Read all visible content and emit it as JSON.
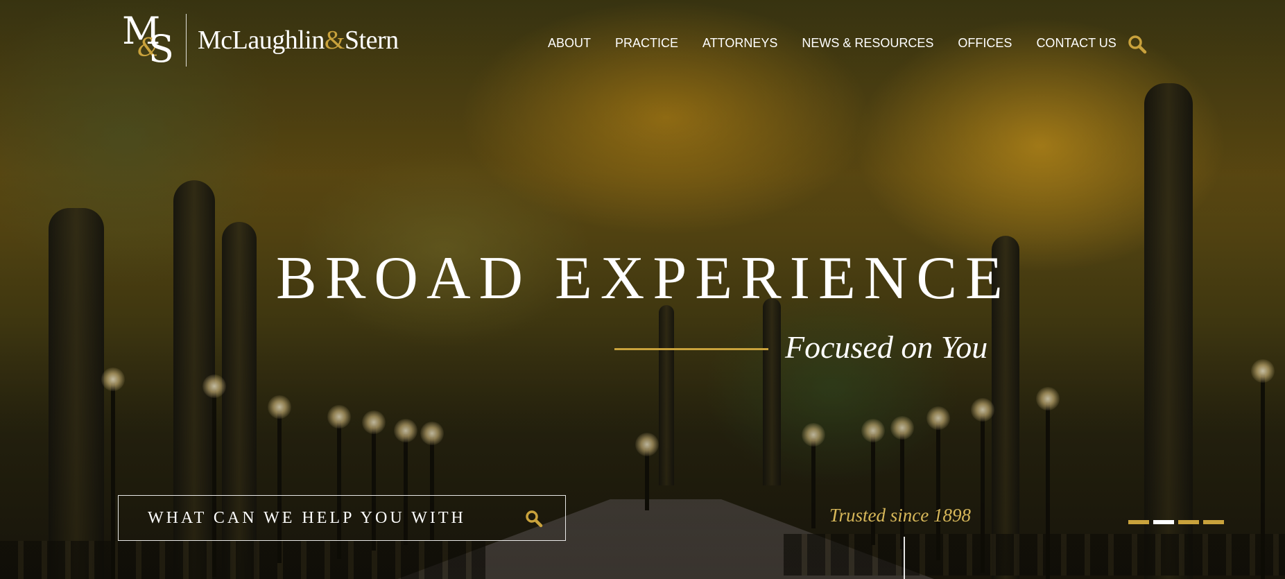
{
  "brand": {
    "mark_m": "M",
    "mark_amp": "&",
    "mark_s": "S",
    "name_first": "McLaughlin",
    "name_amp": "&",
    "name_last": "Stern"
  },
  "nav": {
    "items": [
      {
        "label": "ABOUT"
      },
      {
        "label": "PRACTICE"
      },
      {
        "label": "ATTORNEYS"
      },
      {
        "label": "NEWS & RESOURCES"
      },
      {
        "label": "OFFICES"
      },
      {
        "label": "CONTACT US"
      }
    ],
    "search_icon": "search-icon"
  },
  "hero": {
    "headline": "BROAD EXPERIENCE",
    "tagline": "Focused on You",
    "search_placeholder": "WHAT CAN WE HELP YOU WITH",
    "trusted": "Trusted since 1898",
    "slides": {
      "count": 4,
      "active_index": 1
    }
  },
  "colors": {
    "accent_gold": "#c9a23c",
    "text_white": "#ffffff",
    "trusted_gold": "#d8b85a"
  }
}
